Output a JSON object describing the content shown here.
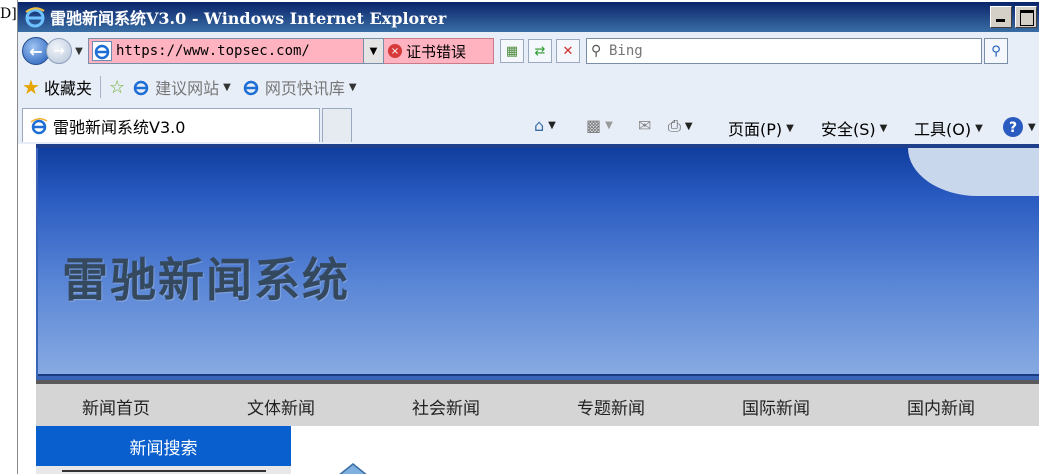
{
  "left_fragment": "D]",
  "window": {
    "title": "雷驰新闻系统V3.0 - Windows Internet Explorer"
  },
  "address_bar": {
    "url": "https://www.topsec.com/",
    "cert_error": "证书错误",
    "search_placeholder": "Bing"
  },
  "favorites_bar": {
    "favorites_label": "收藏夹",
    "links": [
      {
        "label": "建议网站"
      },
      {
        "label": "网页快讯库"
      }
    ]
  },
  "tab": {
    "label": "雷驰新闻系统V3.0"
  },
  "command_bar": {
    "page": "页面(P)",
    "safety": "安全(S)",
    "tools": "工具(O)"
  },
  "site": {
    "banner_title": "雷驰新闻系统",
    "nav": [
      {
        "label": "新闻首页"
      },
      {
        "label": "文体新闻"
      },
      {
        "label": "社会新闻"
      },
      {
        "label": "专题新闻"
      },
      {
        "label": "国际新闻"
      },
      {
        "label": "国内新闻"
      }
    ],
    "sidebar_title": "新闻搜索"
  },
  "colors": {
    "title_bar": "#0a246a",
    "cert_error_bg": "#ffb3c1",
    "banner_blue": "#2a5bc1",
    "nav_bg": "#d5d5d5",
    "sidebar_blue": "#0a5fcf"
  }
}
